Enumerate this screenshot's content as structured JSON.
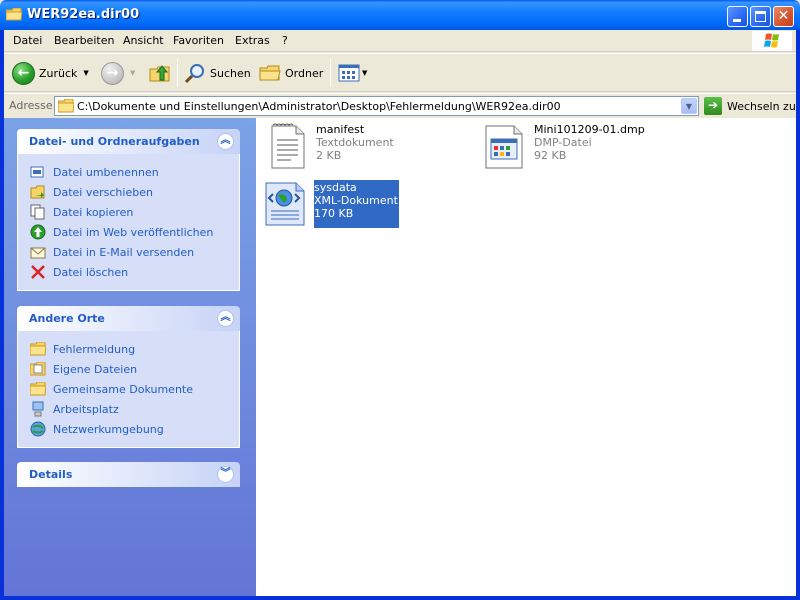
{
  "window": {
    "title": "WER92ea.dir00"
  },
  "menu": {
    "items": [
      {
        "label": "Datei"
      },
      {
        "label": "Bearbeiten"
      },
      {
        "label": "Ansicht"
      },
      {
        "label": "Favoriten"
      },
      {
        "label": "Extras"
      },
      {
        "label": "?"
      }
    ]
  },
  "toolbar": {
    "back_label": "Zurück",
    "search_label": "Suchen",
    "folders_label": "Ordner"
  },
  "address": {
    "label": "Adresse",
    "path": "C:\\Dokumente und Einstellungen\\Administrator\\Desktop\\Fehlermeldung\\WER92ea.dir00",
    "go_label": "Wechseln zu"
  },
  "panels": {
    "tasks": {
      "title": "Datei- und Ordneraufgaben",
      "items": [
        {
          "label": "Datei umbenennen",
          "icon": "rename-icon"
        },
        {
          "label": "Datei verschieben",
          "icon": "move-icon"
        },
        {
          "label": "Datei kopieren",
          "icon": "copy-icon"
        },
        {
          "label": "Datei im Web veröffentlichen",
          "icon": "publish-web-icon"
        },
        {
          "label": "Datei in E-Mail versenden",
          "icon": "email-icon"
        },
        {
          "label": "Datei löschen",
          "icon": "delete-icon"
        }
      ]
    },
    "places": {
      "title": "Andere Orte",
      "items": [
        {
          "label": "Fehlermeldung",
          "icon": "folder-icon"
        },
        {
          "label": "Eigene Dateien",
          "icon": "my-documents-icon"
        },
        {
          "label": "Gemeinsame Dokumente",
          "icon": "shared-documents-icon"
        },
        {
          "label": "Arbeitsplatz",
          "icon": "my-computer-icon"
        },
        {
          "label": "Netzwerkumgebung",
          "icon": "network-icon"
        }
      ]
    },
    "details": {
      "title": "Details"
    }
  },
  "files": [
    {
      "name": "manifest",
      "type": "Textdokument",
      "size": "2 KB",
      "icon": "text-document-icon",
      "selected": false
    },
    {
      "name": "Mini101209-01.dmp",
      "type": "DMP-Datei",
      "size": "92 KB",
      "icon": "dmp-file-icon",
      "selected": false
    },
    {
      "name": "sysdata",
      "type": "XML-Dokument",
      "size": "170 KB",
      "icon": "xml-document-icon",
      "selected": true
    }
  ],
  "colors": {
    "titlebar": "#0058ee",
    "panel_link": "#215dc6",
    "selection": "#316ac5"
  }
}
